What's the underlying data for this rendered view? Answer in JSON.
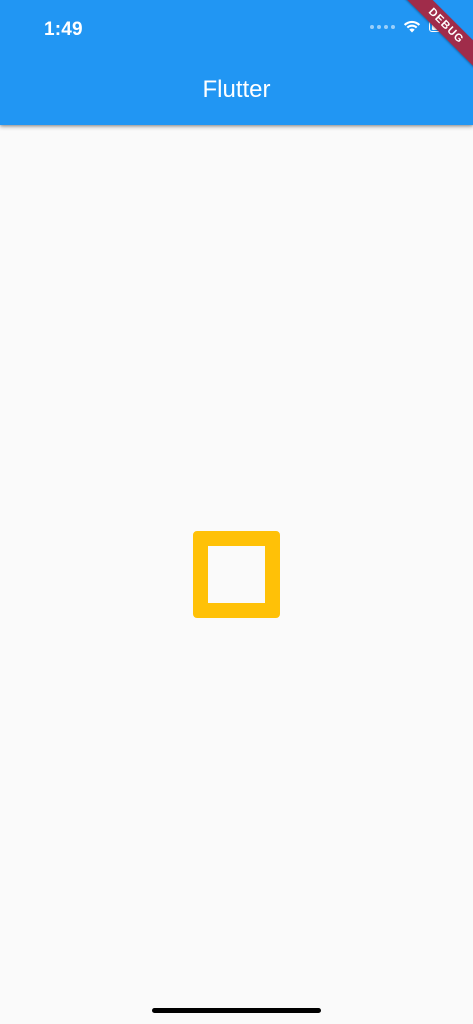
{
  "status_bar": {
    "time": "1:49"
  },
  "app_bar": {
    "title": "Flutter"
  },
  "debug_banner": {
    "label": "DEBUG"
  },
  "colors": {
    "app_bar": "#2196f3",
    "background": "#fafafa",
    "square_border": "#ffc107",
    "debug_banner": "#a02c4a"
  },
  "icons": [
    "signal-dots-icon",
    "wifi-icon",
    "battery-icon"
  ]
}
